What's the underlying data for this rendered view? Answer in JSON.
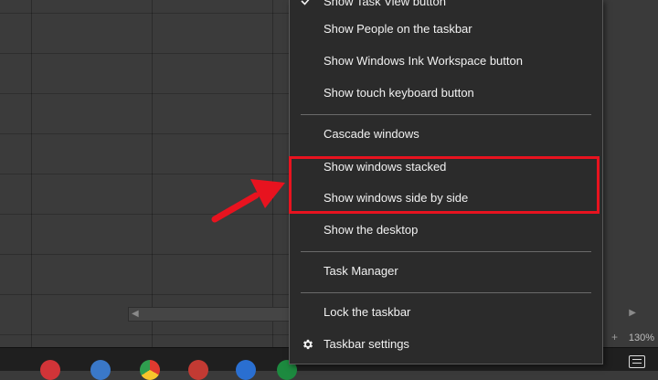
{
  "menu": {
    "items": [
      {
        "label": "Show Task View button",
        "checked": true
      },
      {
        "label": "Show People on the taskbar"
      },
      {
        "label": "Show Windows Ink Workspace button"
      },
      {
        "label": "Show touch keyboard button"
      },
      {
        "label": "Cascade windows"
      },
      {
        "label": "Show windows stacked"
      },
      {
        "label": "Show windows side by side"
      },
      {
        "label": "Show the desktop"
      },
      {
        "label": "Task Manager"
      },
      {
        "label": "Lock the taskbar"
      },
      {
        "label": "Taskbar settings"
      }
    ]
  },
  "status": {
    "zoom": "130%"
  },
  "colors": {
    "highlight": "#e8131f",
    "menu_bg": "#2b2b2b",
    "menu_text": "#f2f2f2"
  },
  "icons": {
    "check": "check-icon",
    "settings": "gear-icon",
    "annotation": "red-arrow-icon"
  }
}
